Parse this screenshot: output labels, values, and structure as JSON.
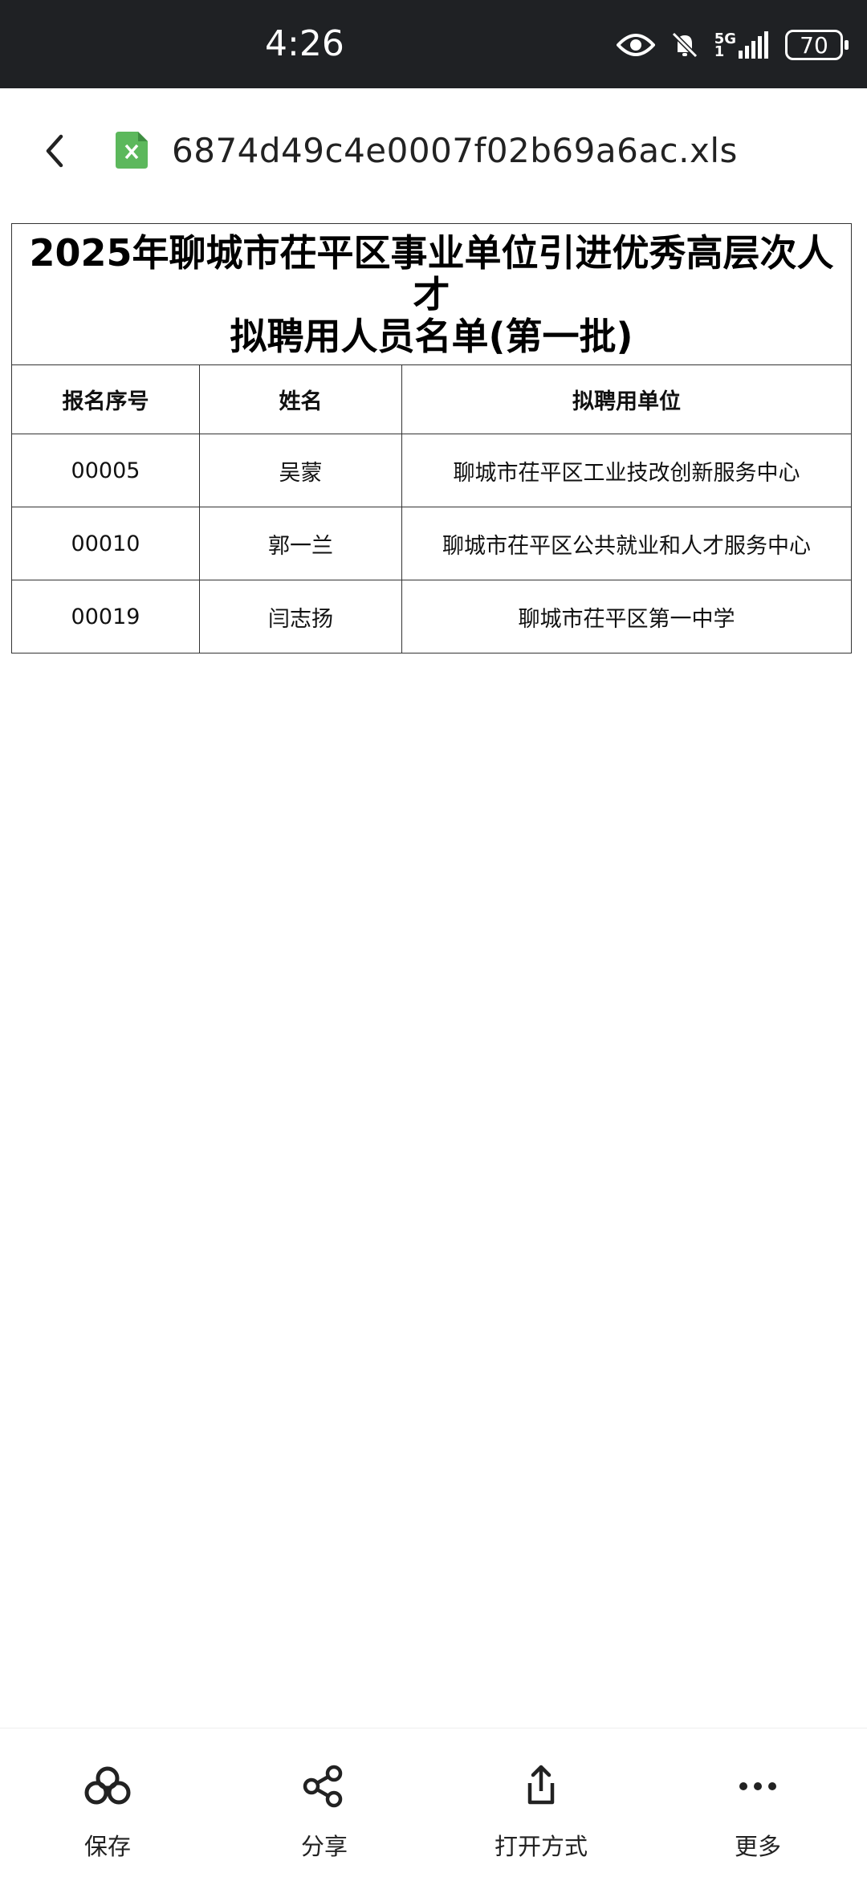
{
  "status_bar": {
    "time": "4:26",
    "network": "5G",
    "network_sub": "1",
    "battery": "70"
  },
  "app_bar": {
    "file_name": "6874d49c4e0007f02b69a6ac.xls",
    "file_icon_color": "#4caf50"
  },
  "sheet": {
    "title_line1": "2025年聊城市茌平区事业单位引进优秀高层次人",
    "title_line2": "才",
    "title_line3": "拟聘用人员名单(第一批)",
    "headers": [
      "报名序号",
      "姓名",
      "拟聘用单位"
    ],
    "rows": [
      [
        "00005",
        "吴蒙",
        "聊城市茌平区工业技改创新服务中心"
      ],
      [
        "00010",
        "郭一兰",
        "聊城市茌平区公共就业和人才服务中心"
      ],
      [
        "00019",
        "闫志扬",
        "聊城市茌平区第一中学"
      ]
    ]
  },
  "bottom_bar": {
    "items": [
      {
        "label": "保存",
        "icon": "cloud-save-icon"
      },
      {
        "label": "分享",
        "icon": "share-icon"
      },
      {
        "label": "打开方式",
        "icon": "open-with-icon"
      },
      {
        "label": "更多",
        "icon": "more-icon"
      }
    ]
  }
}
